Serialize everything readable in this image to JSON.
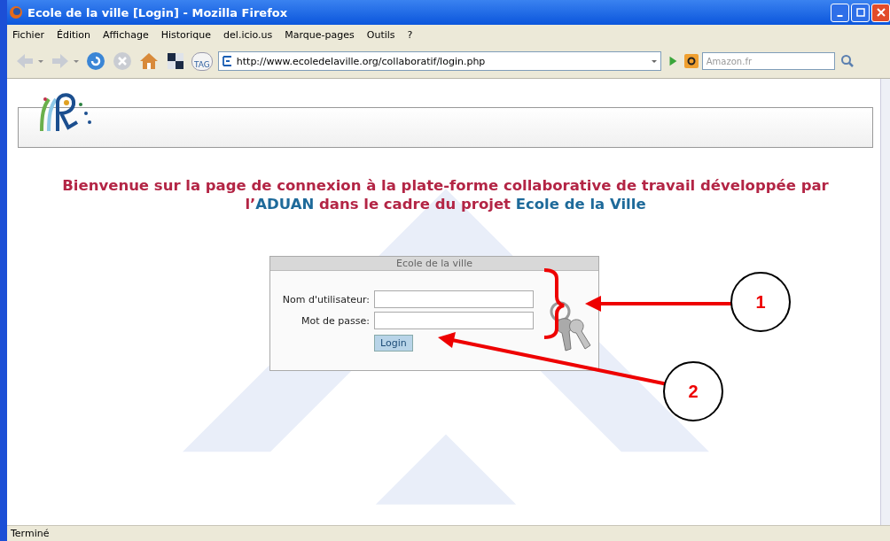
{
  "window": {
    "title": "Ecole de la ville [Login] - Mozilla Firefox"
  },
  "menu": [
    "Fichier",
    "Édition",
    "Affichage",
    "Historique",
    "del.icio.us",
    "Marque-pages",
    "Outils",
    "?"
  ],
  "toolbar": {
    "tag_label": "TAG",
    "url": "http://www.ecoledelaville.org/collaboratif/login.php",
    "search_placeholder": "Amazon.fr"
  },
  "welcome": [
    {
      "text": "Bienvenue sur la page de connexion à la plate-forme collaborative de travail développée par l’",
      "highlight": false
    },
    {
      "text": "ADUAN",
      "highlight": true
    },
    {
      "text": " dans le cadre du projet ",
      "highlight": false
    },
    {
      "text": "Ecole de la Ville",
      "highlight": true
    }
  ],
  "login_box": {
    "title": "Ecole de la ville",
    "fields": [
      {
        "label": "Nom d'utilisateur:"
      },
      {
        "label": "Mot de passe:"
      }
    ],
    "button": "Login"
  },
  "callouts": [
    "1",
    "2"
  ],
  "status_bar": "Terminé"
}
